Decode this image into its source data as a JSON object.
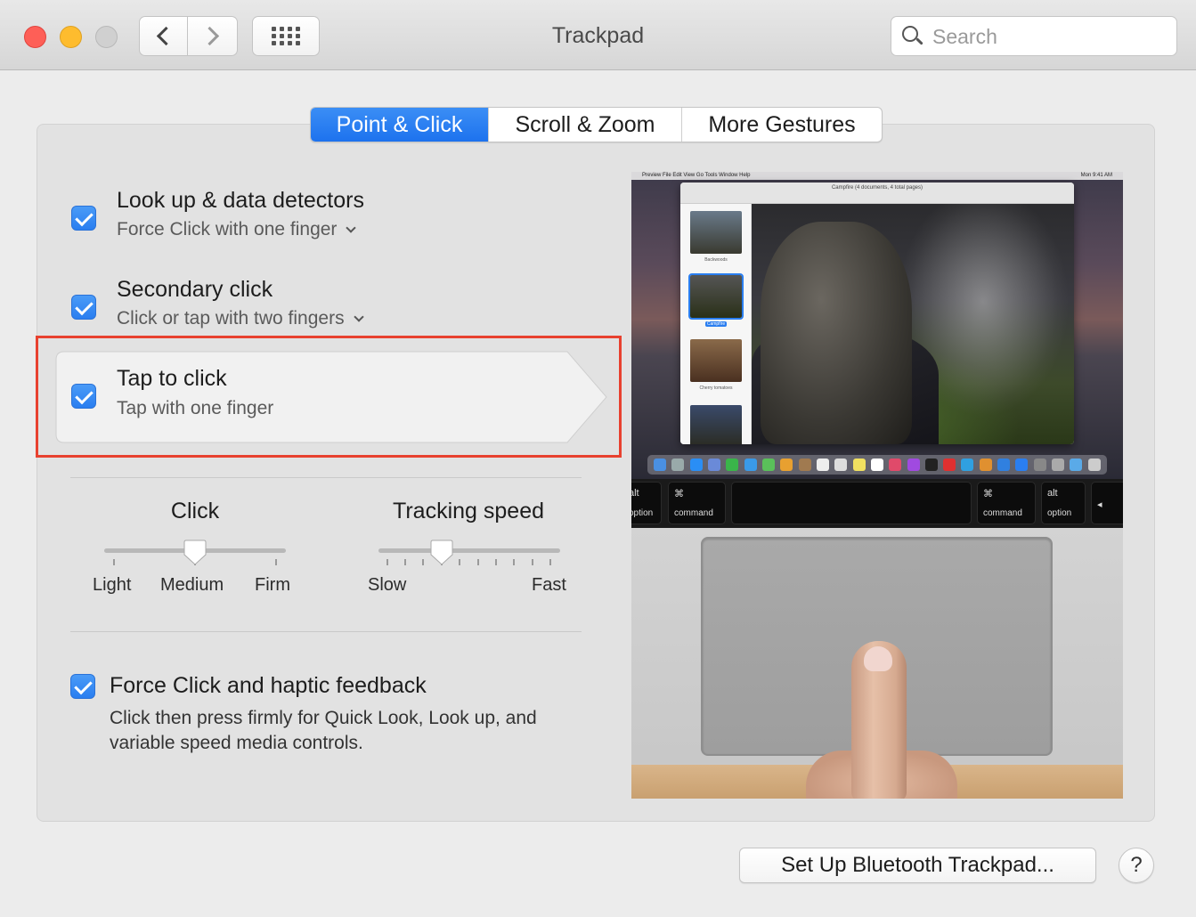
{
  "window": {
    "title": "Trackpad"
  },
  "toolbar": {
    "back_icon": "chevron-left-icon",
    "forward_icon": "chevron-right-icon",
    "show_all_icon": "grid-icon"
  },
  "search": {
    "placeholder": "Search",
    "value": ""
  },
  "tabs": [
    {
      "label": "Point & Click",
      "active": true
    },
    {
      "label": "Scroll & Zoom",
      "active": false
    },
    {
      "label": "More Gestures",
      "active": false
    }
  ],
  "options": [
    {
      "title": "Look up & data detectors",
      "subtitle": "Force Click with one finger",
      "checked": true,
      "has_dropdown": true
    },
    {
      "title": "Secondary click",
      "subtitle": "Click or tap with two fingers",
      "checked": true,
      "has_dropdown": true
    },
    {
      "title": "Tap to click",
      "subtitle": "Tap with one finger",
      "checked": true,
      "has_dropdown": false,
      "highlighted": true
    }
  ],
  "click_slider": {
    "title": "Click",
    "labels": [
      "Light",
      "Medium",
      "Firm"
    ],
    "positions": 3,
    "selected_index": 1
  },
  "tracking_slider": {
    "title": "Tracking speed",
    "min_label": "Slow",
    "max_label": "Fast",
    "positions": 10,
    "selected_index": 3
  },
  "force_click": {
    "title": "Force Click and haptic feedback",
    "description": "Click then press firmly for Quick Look, Look up, and variable speed media controls.",
    "checked": true
  },
  "preview": {
    "menubar_left": "Preview  File  Edit  View  Go  Tools  Window  Help",
    "menubar_right": "Mon 9:41 AM",
    "window_title": "Campfire (4 documents, 4 total pages)",
    "thumbnails": [
      "Backwoods",
      "Campfire",
      "Cherry tomatoes"
    ],
    "keys": {
      "alt": "alt",
      "option": "option",
      "command": "command"
    }
  },
  "buttons": {
    "bluetooth": "Set Up Bluetooth Trackpad...",
    "help": "?"
  },
  "colors": {
    "accent": "#1d72ee",
    "highlight_frame": "#e8412f",
    "close": "#fe5f57",
    "minimize": "#febc2e"
  }
}
